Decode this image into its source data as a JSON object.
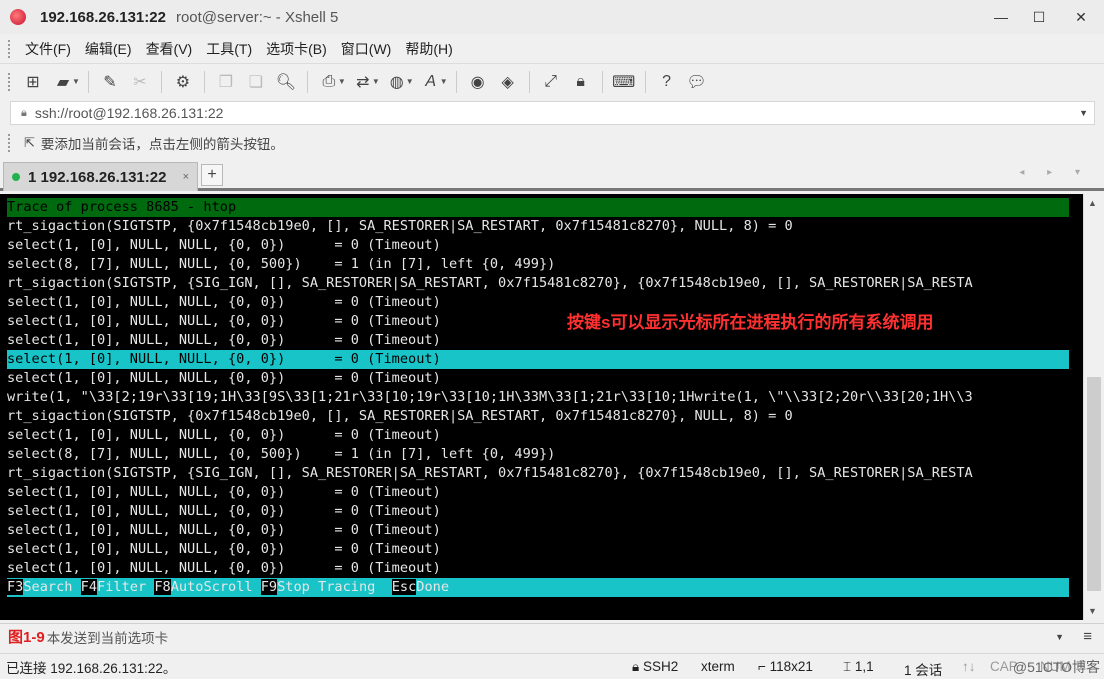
{
  "window": {
    "ip": "192.168.26.131:22",
    "subtitle": "root@server:~ - Xshell 5",
    "minimize": "—",
    "maximize": "☐",
    "close": "✕"
  },
  "menu": [
    "文件(F)",
    "编辑(E)",
    "查看(V)",
    "工具(T)",
    "选项卡(B)",
    "窗口(W)",
    "帮助(H)"
  ],
  "toolbar": {
    "icons": [
      "new-session-icon",
      "open-folder-icon",
      "reconnect-icon",
      "disconnect-icon",
      "properties-icon",
      "copy-icon",
      "paste-icon",
      "find-icon",
      "print-icon",
      "transfer-icon",
      "globe-icon",
      "font-icon",
      "xftp-icon",
      "xmanager-icon",
      "fullscreen-icon",
      "lock-icon",
      "keyboard-icon",
      "help-icon",
      "chat-icon"
    ]
  },
  "address": {
    "value": "ssh://root@192.168.26.131:22"
  },
  "hint": {
    "text": "要添加当前会话，点击左侧的箭头按钮。"
  },
  "tab": {
    "label": "1 192.168.26.131:22",
    "close": "×",
    "add": "+",
    "nav": "◂ ▸ ▾"
  },
  "terminal": {
    "lines": [
      "Trace of process 8685 - htop",
      "rt_sigaction(SIGTSTP, {0x7f1548cb19e0, [], SA_RESTORER|SA_RESTART, 0x7f15481c8270}, NULL, 8) = 0",
      "select(1, [0], NULL, NULL, {0, 0})      = 0 (Timeout)",
      "select(8, [7], NULL, NULL, {0, 500})    = 1 (in [7], left {0, 499})",
      "rt_sigaction(SIGTSTP, {SIG_IGN, [], SA_RESTORER|SA_RESTART, 0x7f15481c8270}, {0x7f1548cb19e0, [], SA_RESTORER|SA_RESTA",
      "select(1, [0], NULL, NULL, {0, 0})      = 0 (Timeout)",
      "select(1, [0], NULL, NULL, {0, 0})      = 0 (Timeout)",
      "select(1, [0], NULL, NULL, {0, 0})      = 0 (Timeout)",
      "select(1, [0], NULL, NULL, {0, 0})      = 0 (Timeout)",
      "select(1, [0], NULL, NULL, {0, 0})      = 0 (Timeout)",
      "write(1, \"\\33[2;19r\\33[19;1H\\33[9S\\33[1;21r\\33[10;19r\\33[10;1H\\33M\\33[1;21r\\33[10;1Hwrite(1, \\\"\\\\33[2;20r\\\\33[20;1H\\\\3",
      "rt_sigaction(SIGTSTP, {0x7f1548cb19e0, [], SA_RESTORER|SA_RESTART, 0x7f15481c8270}, NULL, 8) = 0",
      "select(1, [0], NULL, NULL, {0, 0})      = 0 (Timeout)",
      "select(8, [7], NULL, NULL, {0, 500})    = 1 (in [7], left {0, 499})",
      "rt_sigaction(SIGTSTP, {SIG_IGN, [], SA_RESTORER|SA_RESTART, 0x7f15481c8270}, {0x7f1548cb19e0, [], SA_RESTORER|SA_RESTA",
      "select(1, [0], NULL, NULL, {0, 0})      = 0 (Timeout)",
      "select(1, [0], NULL, NULL, {0, 0})      = 0 (Timeout)",
      "select(1, [0], NULL, NULL, {0, 0})      = 0 (Timeout)",
      "select(1, [0], NULL, NULL, {0, 0})      = 0 (Timeout)",
      "select(1, [0], NULL, NULL, {0, 0})      = 0 (Timeout)"
    ],
    "annotation": "按键s可以显示光标所在进程执行的所有系统调用",
    "fkeys": [
      {
        "key": "F3",
        "label": "Search "
      },
      {
        "key": "F4",
        "label": "Filter "
      },
      {
        "key": "F8",
        "label": "AutoScroll "
      },
      {
        "key": "F9",
        "label": "Stop Tracing  "
      },
      {
        "key": "Esc",
        "label": "Done"
      }
    ]
  },
  "compose": {
    "figure_label": "图1-9",
    "text": "本发送到当前选项卡"
  },
  "status": {
    "connected": "已连接 192.168.26.131:22。",
    "protocol": "SSH2",
    "term": "xterm",
    "size": "118x21",
    "cursor": "1,1",
    "sessions": "1 会话",
    "caps": "CAP",
    "num": "NUM",
    "watermark": "@51CTO博客"
  }
}
